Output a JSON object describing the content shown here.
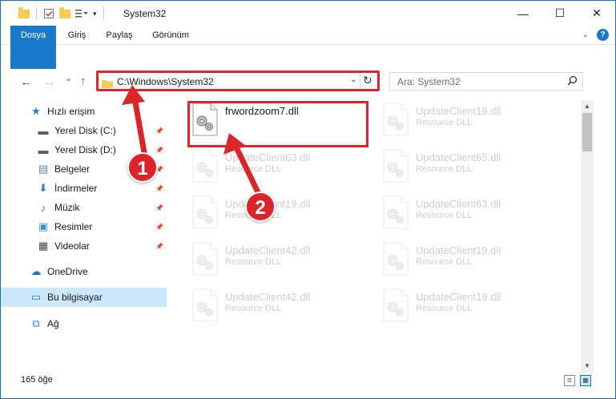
{
  "window": {
    "title": "System32",
    "controls": {
      "minimize": "—",
      "maximize": "☐",
      "close": "✕"
    }
  },
  "ribbon": {
    "tabs": [
      "Dosya",
      "Giriş",
      "Paylaş",
      "Görünüm"
    ],
    "help": "?"
  },
  "nav": {
    "back": "←",
    "forward": "→",
    "recent": "⌄",
    "up": "↑",
    "address": "C:\\Windows\\System32",
    "address_dropdown": "⌄",
    "refresh": "↻",
    "search_placeholder": "Ara: System32"
  },
  "sidebar": {
    "items": [
      {
        "label": "Hızlı erişim",
        "icon": "star-icon",
        "glyph": "★",
        "color": "#2b7cd3",
        "pinned": false
      },
      {
        "label": "Yerel Disk (C:)",
        "icon": "drive-icon",
        "glyph": "▬",
        "color": "#5a5a5a",
        "pinned": true
      },
      {
        "label": "Yerel Disk (D:)",
        "icon": "drive-icon",
        "glyph": "▬",
        "color": "#5a5a5a",
        "pinned": true
      },
      {
        "label": "Belgeler",
        "icon": "documents-icon",
        "glyph": "▤",
        "color": "#5f7fa8",
        "pinned": true
      },
      {
        "label": "İndirmeler",
        "icon": "download-icon",
        "glyph": "⬇",
        "color": "#2b7cd3",
        "pinned": true
      },
      {
        "label": "Müzik",
        "icon": "music-icon",
        "glyph": "♪",
        "color": "#3a73c8",
        "pinned": true
      },
      {
        "label": "Resimler",
        "icon": "pictures-icon",
        "glyph": "▣",
        "color": "#3b8fd6",
        "pinned": true
      },
      {
        "label": "Videolar",
        "icon": "video-icon",
        "glyph": "▦",
        "color": "#444",
        "pinned": true
      },
      {
        "label": "OneDrive",
        "icon": "cloud-icon",
        "glyph": "☁",
        "color": "#1f6fc5",
        "pinned": false
      },
      {
        "label": "Bu bilgisayar",
        "icon": "computer-icon",
        "glyph": "▭",
        "color": "#2b7cd3",
        "pinned": false
      },
      {
        "label": "Ağ",
        "icon": "network-icon",
        "glyph": "⧉",
        "color": "#2b7cd3",
        "pinned": false
      }
    ]
  },
  "files": [
    {
      "name": "frwordzoom7.dll",
      "sub": "",
      "highlighted": true
    },
    {
      "name": "UpdateClient19.dll",
      "sub": "Resource DLL",
      "highlighted": false
    },
    {
      "name": "UpdateClient63.dll",
      "sub": "Resource DLL",
      "highlighted": false
    },
    {
      "name": "UpdateClient65.dll",
      "sub": "Resource DLL",
      "highlighted": false
    },
    {
      "name": "UpdateClient19.dll",
      "sub": "Resource DLL",
      "highlighted": false
    },
    {
      "name": "UpdateClient63.dll",
      "sub": "Resource DLL",
      "highlighted": false
    },
    {
      "name": "UpdateClient42.dll",
      "sub": "Resource DLL",
      "highlighted": false
    },
    {
      "name": "UpdateClient19.dll",
      "sub": "Resource DLL",
      "highlighted": false
    },
    {
      "name": "UpdateClient42.dll",
      "sub": "Resource DLL",
      "highlighted": false
    },
    {
      "name": "UpdateClient19.dll",
      "sub": "Resource DLL",
      "highlighted": false
    }
  ],
  "status": {
    "item_count": "165 öğe"
  },
  "annotations": {
    "step1": "1",
    "step2": "2",
    "color": "#d9262d"
  }
}
